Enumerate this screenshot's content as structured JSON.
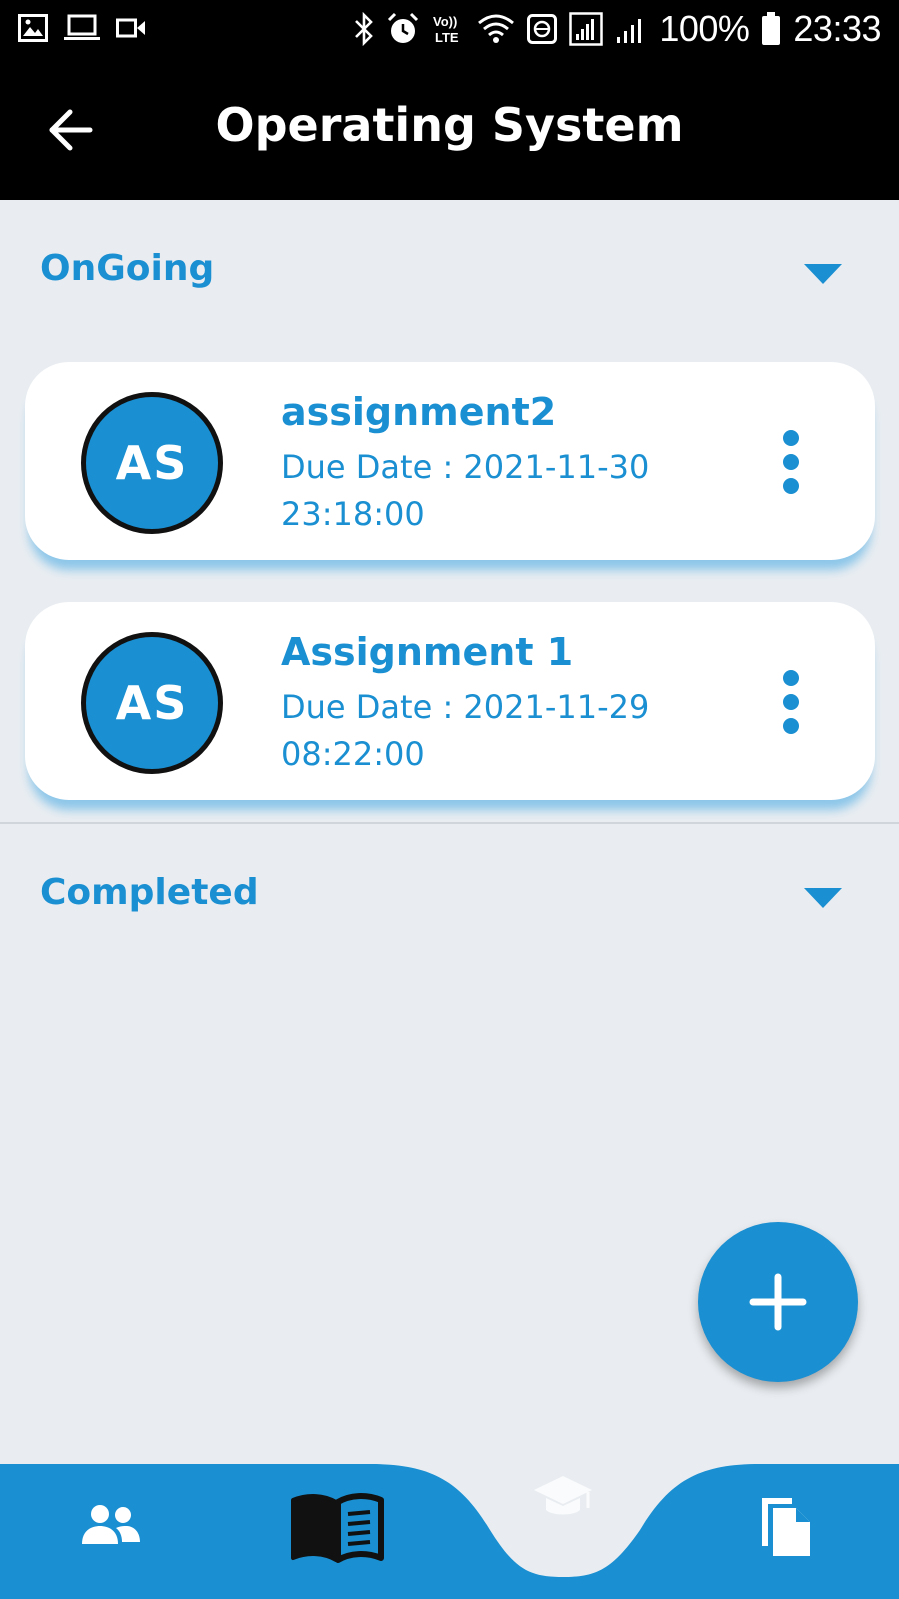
{
  "status_bar": {
    "battery": "100%",
    "time": "23:33",
    "left_icons": [
      "gallery-icon",
      "laptop-icon",
      "video-icon"
    ],
    "right_icons": [
      "bluetooth-icon",
      "alarm-icon",
      "volte-icon",
      "wifi-icon",
      "vpn-icon",
      "signal-icon",
      "signal-icon"
    ]
  },
  "header": {
    "title": "Operating System",
    "back_icon": "arrow-left-icon"
  },
  "sections": {
    "ongoing": {
      "label": "OnGoing"
    },
    "completed": {
      "label": "Completed"
    }
  },
  "assignments": [
    {
      "initials": "AS",
      "title": "assignment2",
      "due": "Due Date :  2021-11-30 23:18:00"
    },
    {
      "initials": "AS",
      "title": "Assignment 1",
      "due": "Due Date :  2021-11-29 08:22:00"
    }
  ],
  "fab": {
    "icon": "plus-icon"
  },
  "bottom_nav": {
    "items": [
      "people-icon",
      "book-icon",
      "graduation-cap-icon",
      "files-icon"
    ],
    "active": "book-icon"
  },
  "colors": {
    "accent": "#1a8fd1",
    "background": "#e9edf1",
    "app_bar": "#000000"
  }
}
